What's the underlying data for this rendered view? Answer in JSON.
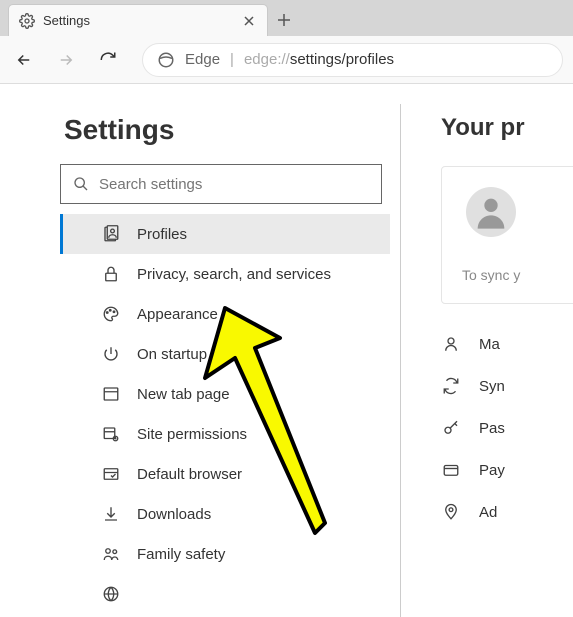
{
  "tab": {
    "title": "Settings"
  },
  "addressbar": {
    "label": "Edge",
    "url_prefix": "edge://",
    "url_page": "settings/profiles"
  },
  "sidebar": {
    "title": "Settings",
    "search_placeholder": "Search settings",
    "items": [
      {
        "label": "Profiles",
        "active": true
      },
      {
        "label": "Privacy, search, and services",
        "active": false
      },
      {
        "label": "Appearance",
        "active": false
      },
      {
        "label": "On startup",
        "active": false
      },
      {
        "label": "New tab page",
        "active": false
      },
      {
        "label": "Site permissions",
        "active": false
      },
      {
        "label": "Default browser",
        "active": false
      },
      {
        "label": "Downloads",
        "active": false
      },
      {
        "label": "Family safety",
        "active": false
      }
    ]
  },
  "content": {
    "title": "Your pr",
    "sync_text": "To sync y",
    "items": [
      {
        "label": "Ma"
      },
      {
        "label": "Syn"
      },
      {
        "label": "Pas"
      },
      {
        "label": "Pay"
      },
      {
        "label": "Ad"
      }
    ]
  }
}
